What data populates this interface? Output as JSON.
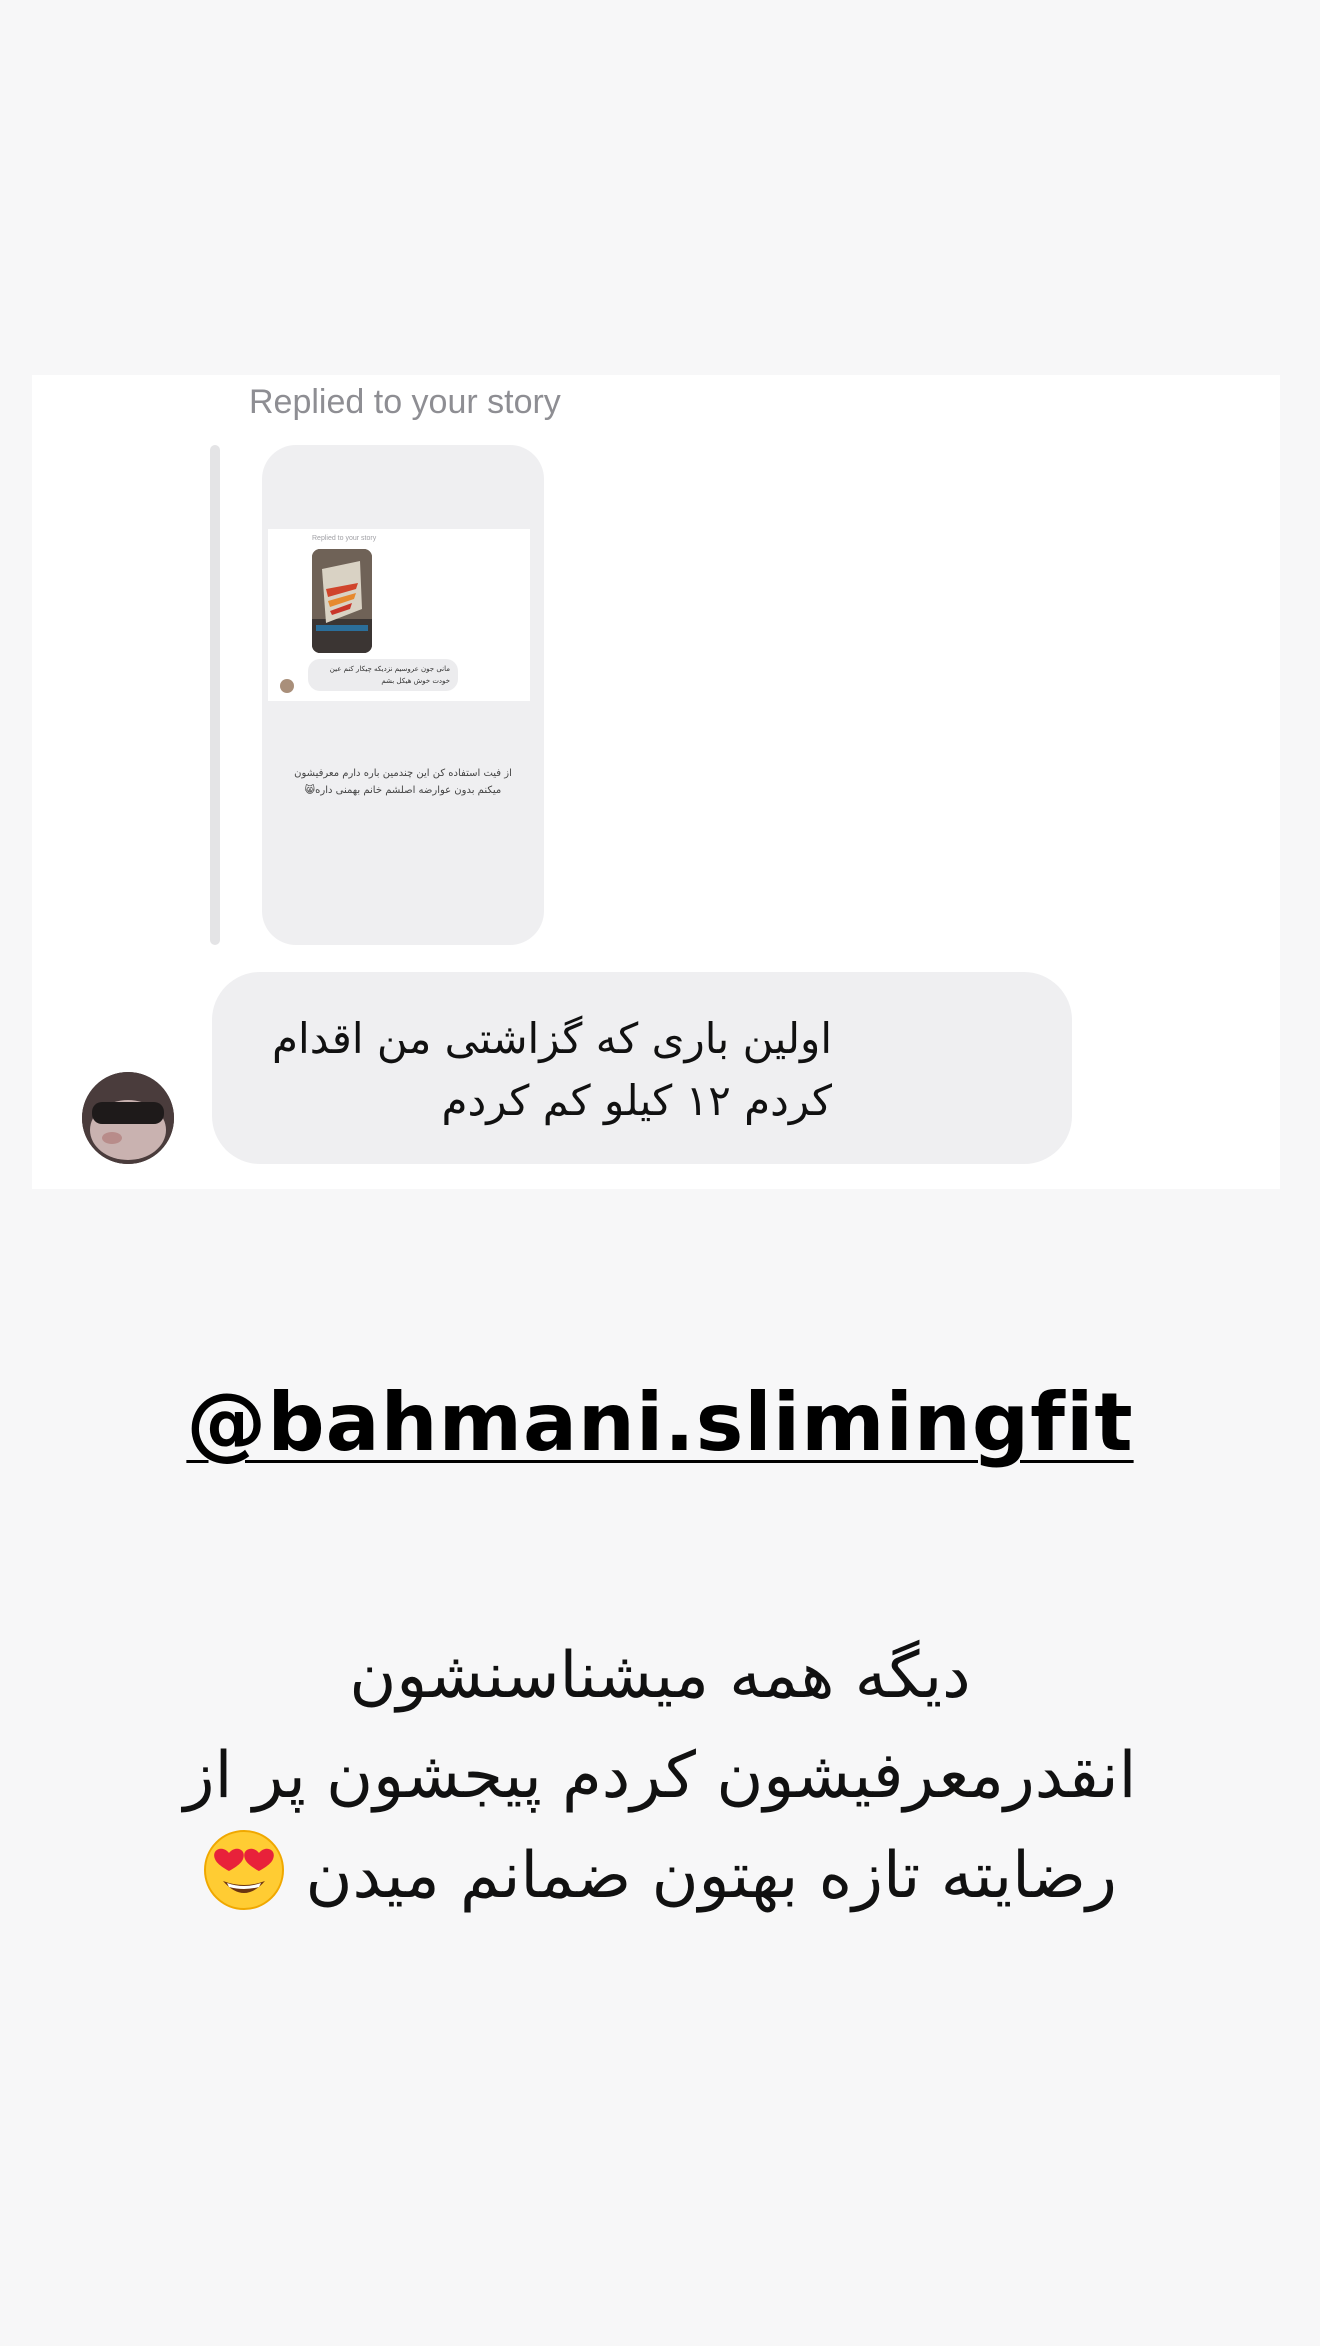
{
  "screenshot": {
    "replied_label": "Replied to your story",
    "story": {
      "inner_replied_label": "Replied to your story",
      "inner_bubble_text": "مانی جون عروسیم نزدیکه چیکار کنم عین خودت خوش هیکل بشم",
      "caption": "از فیت استفاده کن این چندمین باره دارم معرفیشون میکنم بدون عوارضه اصلشم خانم بهمنی داره😸"
    },
    "message": {
      "text": "اولین باری که گزاشتی من اقدام کردم ۱۲ کیلو کم کردم"
    }
  },
  "handle": "@bahmani.slimingfit",
  "caption": {
    "line1": "دیگه همه میشناسنشون",
    "line2": "انقدرمعرفیشون کردم پیجشون پر از",
    "line3": "رضایته تازه بهتون ضمانم میدن"
  },
  "icons": {
    "emoji": "heart-eyes-emoji-icon"
  }
}
